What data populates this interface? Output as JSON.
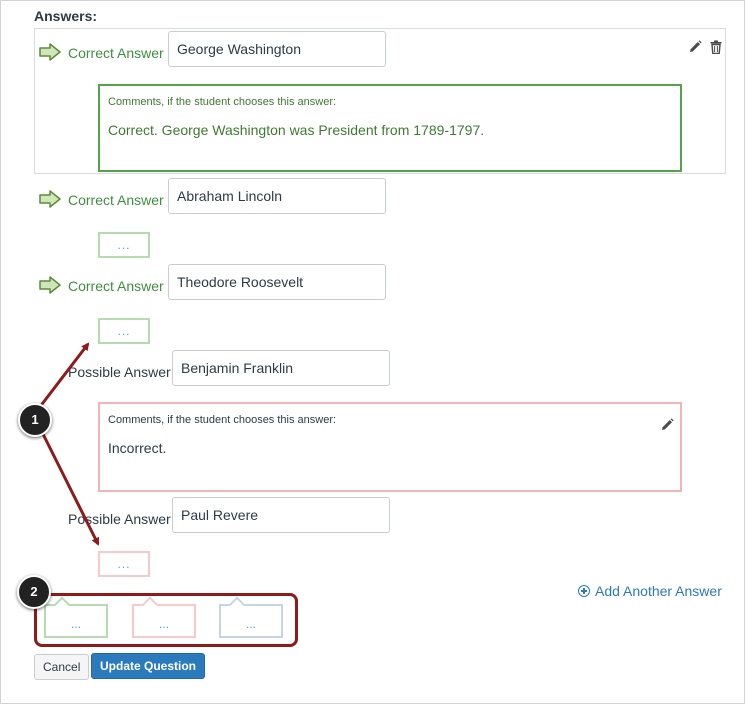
{
  "header": {
    "title": "Answers:"
  },
  "answers": [
    {
      "type_label": "Correct Answer",
      "value": "George Washington",
      "comment_title": "Comments, if the student chooses this answer:",
      "comment_text": "Correct. George Washington was President from 1789-1797."
    },
    {
      "type_label": "Correct Answer",
      "value": "Abraham Lincoln",
      "comment_button": "..."
    },
    {
      "type_label": "Correct Answer",
      "value": "Theodore Roosevelt",
      "comment_button": "..."
    },
    {
      "type_label": "Possible Answer",
      "value": "Benjamin Franklin",
      "comment_title": "Comments, if the student chooses this answer:",
      "comment_text": "Incorrect."
    },
    {
      "type_label": "Possible Answer",
      "value": "Paul Revere",
      "comment_button": "..."
    }
  ],
  "add_answer_label": "Add Another Answer",
  "general_comments": [
    {
      "label": "...",
      "kind": "correct"
    },
    {
      "label": "...",
      "kind": "wrong"
    },
    {
      "label": "...",
      "kind": "general"
    }
  ],
  "callouts": {
    "one": "1",
    "two": "2"
  },
  "buttons": {
    "cancel": "Cancel",
    "update": "Update Question"
  },
  "colors": {
    "correct": "#3f8f3f",
    "wrong_border": "#f1b5b8",
    "link": "#2b7abc",
    "callout_line": "#8e1a1a"
  }
}
